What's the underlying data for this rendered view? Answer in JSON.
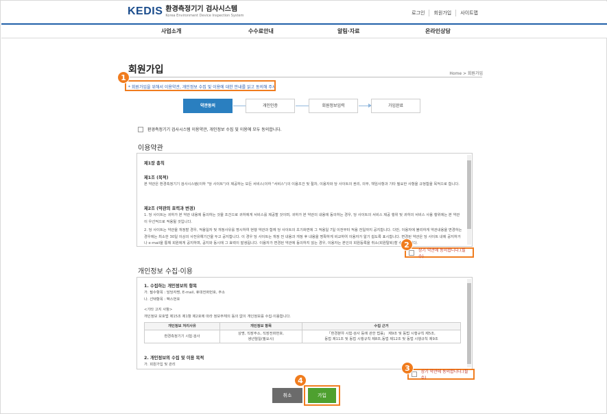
{
  "header": {
    "logo_mark": "KEDIS",
    "logo_title": "환경측정기기 검사시스템",
    "logo_sub": "Korea Environment Device Inspection System",
    "util": [
      "로그인",
      "회원가입",
      "사이트맵"
    ]
  },
  "nav": [
    "사업소개",
    "수수료안내",
    "알림·자료",
    "온라인상담"
  ],
  "page": {
    "title": "회원가입",
    "breadcrumb": "Home  >  회원가입",
    "notice": "* 회원가입을 위해서 이용약관, 개인정보 수집 및 이용에 대한 안내를 읽고 동의해 주세요."
  },
  "steps": [
    "약관동의",
    "개인인증",
    "회원정보입력",
    "가입완료"
  ],
  "agree_all": "환경측정기기 검사시스템 이용약관, 개인정보 수집 및 이용에 모두 동의합니다.",
  "terms": {
    "title": "이용약관",
    "chapter": "제1장 총칙",
    "art1_title": "제1조 (목적)",
    "art1_body": "본 약관은 환경측정기기 검사시스템(이하 \"당 사이트\")이 제공하는 모든 서비스(이하 \"서비스\")의 이용조건 및 절차, 이용자와 당 사이트의 권리, 의무, 책임사항과 기타 필요한 사항을 규정함을 목적으로 합니다.",
    "art2_title": "제2조 (약관의 효력과 변경)",
    "art2_p1": "1. 당 사이트는 귀하가 본 약관 내용에 동의하는 것을 조건으로 귀하에게 서비스를 제공할 것이며, 귀하가 본 약관의 내용에 동의하는 경우, 당 사이트의 서비스 제공 행위 및 귀하의 서비스 사용 행위에는 본 약관이 우선적으로 적용될 것입니다.",
    "art2_p2": "2. 당 사이트는 약관을 개정할 경우, 적용일자 및 개정사유를 명시하여 현행 약관과 함께 당 사이트의 초기화면에 그 적용일 7일 이전부터 적용 전일까지 공지합니다. 다만, 이용자에 불리하게 약관내용을 변경하는 경우에는 최소한 30일 이상의 사전유예기간을 두고 공지합니다. 이 경우 당 사이트는 개정 전 내용과 개정 후 내용을 명확하게 비교하여 이용자가 알기 쉽도록 표시합니다. 변경된 약관은 당 사이트 내에 공지하거나 e-mail을 통해 회원에게 공지하며, 공지와 동시에 그 효력이 발생됩니다. 이용자가 변경된 약관에 동의하지 않는 경우, 이용자는 본인의 회원등록을 취소(회원탈퇴)할 수 있습니다.",
    "agree_label": "상기 약관에 동의합니다.(필수)"
  },
  "privacy": {
    "title": "개인정보 수집·이용",
    "sec1_title": "1. 수집하는 개인정보의 항목",
    "sec1_a": "가. 필수항목 : 담당자명, E-mail, 휴대전화번호, 주소",
    "sec1_b": "나. 선택항목 : 팩스번호",
    "other_title": "<기타 고지 사항>",
    "other_body": "개인정보 보호법 제15조 제1항 제2호에 따라 정보주체의 동의 없이 개인정보를 수집·이용합니다.",
    "table_headers": [
      "개인정보 처리사유",
      "개인정보 항목",
      "수집 근거"
    ],
    "table_row": {
      "reason": "환경측정기기 시험·검사",
      "items": [
        "상명, 직장주소, 직장전화번호,",
        "생년월일(필요시)"
      ],
      "basis": [
        "「환경분야 시험·검사 등에 관한 법률」 제9조 및 동법 시행규칙 제5조,",
        "동법 제11조 및 동법 시행규칙 제8조,동법 제12조 및 동법 시행규칙 제9조"
      ]
    },
    "sec2_title": "2. 개인정보의 수집 및 이용 목적",
    "sec2_a": "가. 회원가입 및 관리",
    "agree_label": "상기 약관에 동의합니다.(필수)"
  },
  "buttons": {
    "cancel": "취소",
    "join": "가입"
  },
  "badges": [
    "1",
    "2",
    "3",
    "4"
  ],
  "colors": {
    "accent_orange": "#f07c1e",
    "primary_blue": "#2a7fc0",
    "join_green": "#4ea02f"
  }
}
